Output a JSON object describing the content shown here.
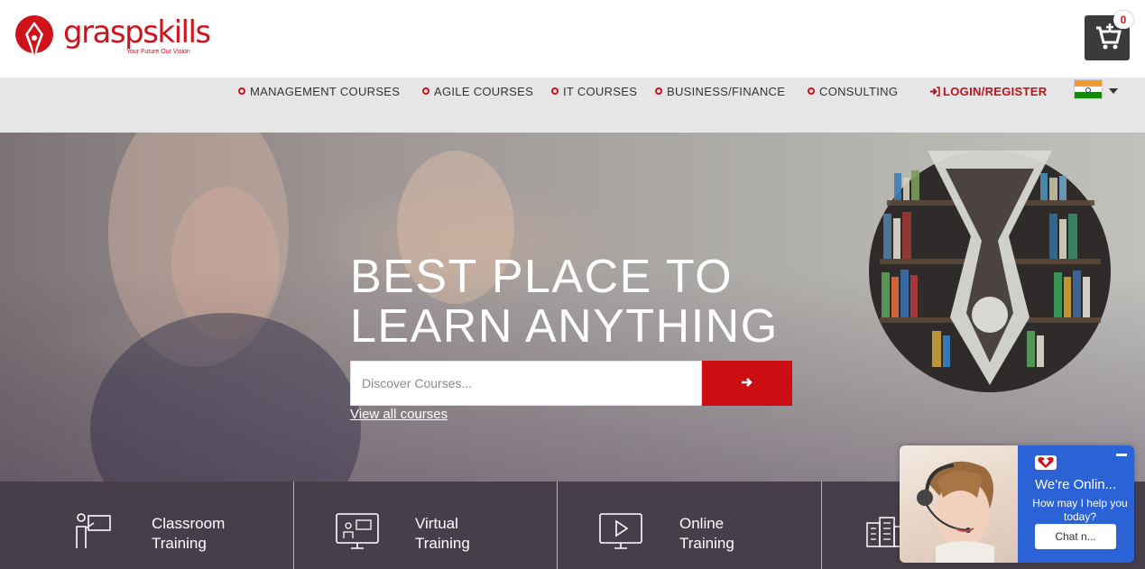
{
  "brand": {
    "name": "graspskills",
    "tagline": "Your Future Our Vision",
    "color": "#d0121b"
  },
  "cart": {
    "count": "0"
  },
  "nav": {
    "items": [
      {
        "label": "MANAGEMENT COURSES"
      },
      {
        "label": "AGILE COURSES"
      },
      {
        "label": "IT COURSES"
      },
      {
        "label": "BUSINESS/FINANCE"
      },
      {
        "label": "CONSULTING"
      }
    ],
    "login_label": "LOGIN/REGISTER",
    "country_flag": "india-flag-icon"
  },
  "hero": {
    "title_line1": "BEST PLACE TO",
    "title_line2": "LEARN ANYTHING",
    "search_placeholder": "Discover Courses...",
    "view_all": "View all courses"
  },
  "training": [
    {
      "line1": "Classroom",
      "line2": "Training",
      "icon": "classroom-icon"
    },
    {
      "line1": "Virtual",
      "line2": "Training",
      "icon": "monitor-presentation-icon"
    },
    {
      "line1": "Online",
      "line2": "Training",
      "icon": "play-screen-icon"
    },
    {
      "line1": "",
      "line2": "",
      "icon": "building-icon"
    }
  ],
  "chat": {
    "title": "We're Onlin...",
    "subtitle": "How may I help you today?",
    "button": "Chat n..."
  }
}
